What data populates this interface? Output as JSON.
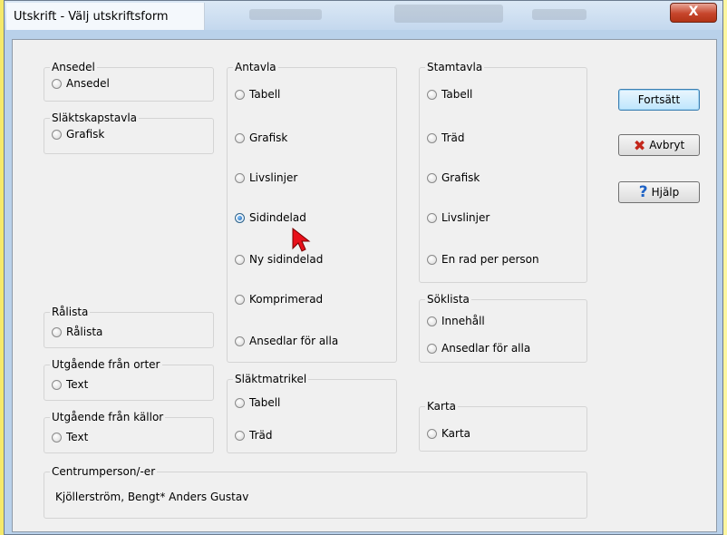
{
  "window": {
    "title": "Utskrift - Välj utskriftsform",
    "close_glyph": "X"
  },
  "groups": {
    "ansedel": {
      "title": "Ansedel",
      "options": [
        "Ansedel"
      ]
    },
    "slaktskapstavla": {
      "title": "Släktskapstavla",
      "options": [
        "Grafisk"
      ]
    },
    "antavla": {
      "title": "Antavla",
      "options": [
        "Tabell",
        "Grafisk",
        "Livslinjer",
        "Sidindelad",
        "Ny sidindelad",
        "Komprimerad",
        "Ansedlar för alla"
      ],
      "selected": "Sidindelad"
    },
    "stamtavla": {
      "title": "Stamtavla",
      "options": [
        "Tabell",
        "Träd",
        "Grafisk",
        "Livslinjer",
        "En rad per person"
      ]
    },
    "soklista": {
      "title": "Söklista",
      "options": [
        "Innehåll",
        "Ansedlar för alla"
      ]
    },
    "ralista": {
      "title": "Rålista",
      "options": [
        "Rålista"
      ]
    },
    "orter": {
      "title": "Utgående från orter",
      "options": [
        "Text"
      ]
    },
    "kallor": {
      "title": "Utgående från källor",
      "options": [
        "Text"
      ]
    },
    "slaktmatrikel": {
      "title": "Släktmatrikel",
      "options": [
        "Tabell",
        "Träd"
      ]
    },
    "karta": {
      "title": "Karta",
      "options": [
        "Karta"
      ]
    },
    "centrumperson": {
      "title": "Centrumperson/-er",
      "value": "Kjöllerström, Bengt* Anders Gustav"
    }
  },
  "buttons": {
    "continue": "Fortsätt",
    "cancel": "Avbryt",
    "help": "Hjälp"
  },
  "icons": {
    "cancel": "red-x-icon",
    "help": "question-mark-icon",
    "pointer": "mouse-cursor-icon"
  },
  "colors": {
    "title_bar": "#c4d8ee",
    "close_button": "#c6452b",
    "dialog_bg": "#f0f0f0",
    "cursor": "#e8101a",
    "desktop": "#fdf6a0"
  }
}
